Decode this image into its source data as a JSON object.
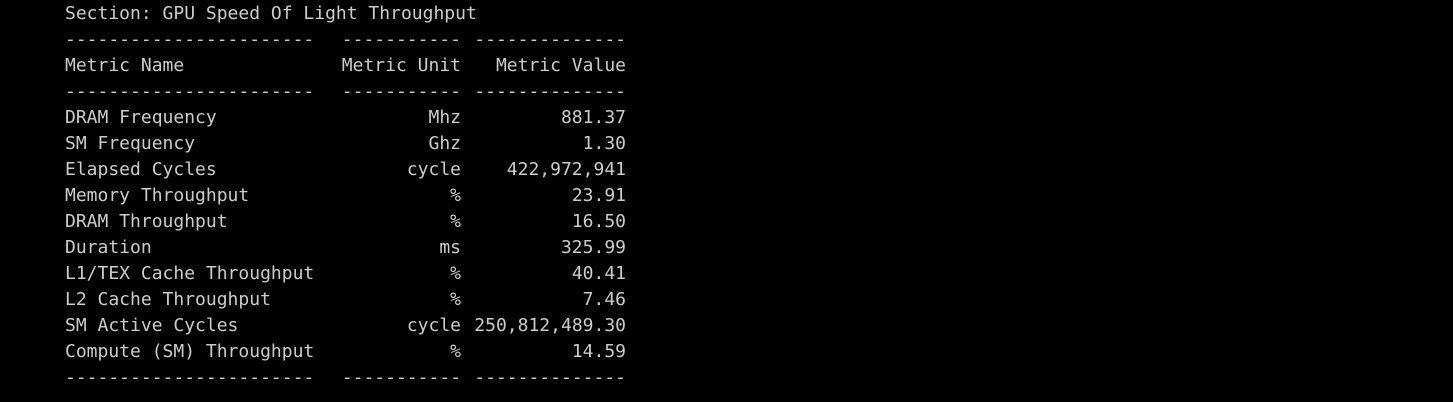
{
  "section_title": "Section: GPU Speed Of Light Throughput",
  "divider": {
    "name": "-----------------------",
    "unit": "-----------",
    "value": "--------------"
  },
  "headers": {
    "name": "Metric Name",
    "unit": "Metric Unit",
    "value": "Metric Value"
  },
  "rows": [
    {
      "name": "DRAM Frequency",
      "unit": "Mhz",
      "value": "881.37"
    },
    {
      "name": "SM Frequency",
      "unit": "Ghz",
      "value": "1.30"
    },
    {
      "name": "Elapsed Cycles",
      "unit": "cycle",
      "value": "422,972,941"
    },
    {
      "name": "Memory Throughput",
      "unit": "%",
      "value": "23.91"
    },
    {
      "name": "DRAM Throughput",
      "unit": "%",
      "value": "16.50"
    },
    {
      "name": "Duration",
      "unit": "ms",
      "value": "325.99"
    },
    {
      "name": "L1/TEX Cache Throughput",
      "unit": "%",
      "value": "40.41"
    },
    {
      "name": "L2 Cache Throughput",
      "unit": "%",
      "value": "7.46"
    },
    {
      "name": "SM Active Cycles",
      "unit": "cycle",
      "value": "250,812,489.30"
    },
    {
      "name": "Compute (SM) Throughput",
      "unit": "%",
      "value": "14.59"
    }
  ]
}
